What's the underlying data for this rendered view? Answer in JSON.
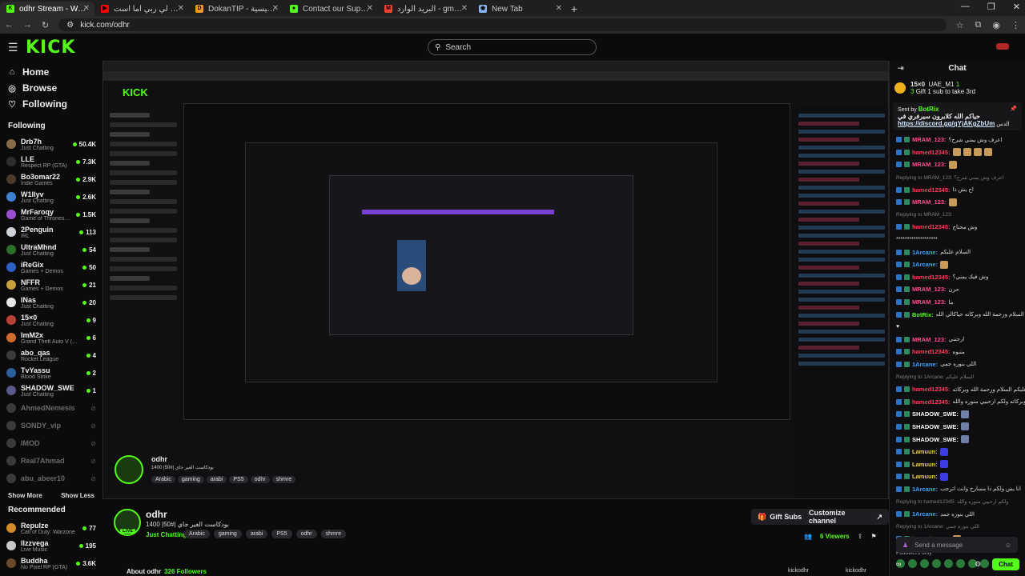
{
  "browser": {
    "tabs": [
      {
        "title": "odhr Stream - Watch Live on Ki",
        "color": "#53fc18",
        "fav": "K",
        "active": true
      },
      {
        "title": "انشودة اذا ما قال لي ربي اما است",
        "color": "#ff0000",
        "fav": "▶",
        "active": false
      },
      {
        "title": "DokanTIP - الرئيسية",
        "color": "#f29a1d",
        "fav": "D",
        "active": false
      },
      {
        "title": "Contact our Support Team | Kic",
        "color": "#53fc18",
        "fav": "●",
        "active": false
      },
      {
        "title": "البريد الوارد - gmail.com - Gmail",
        "color": "#ea4335",
        "fav": "M",
        "active": false
      },
      {
        "title": "New Tab",
        "color": "#8ab4f8",
        "fav": "◉",
        "active": false
      }
    ],
    "url": "kick.com/odhr"
  },
  "header": {
    "logo": "KICK",
    "search_placeholder": "Search"
  },
  "sidebar": {
    "nav": [
      {
        "label": "Home",
        "icon": "home-icon",
        "glyph": "⌂"
      },
      {
        "label": "Browse",
        "icon": "browse-icon",
        "glyph": "◎"
      },
      {
        "label": "Following",
        "icon": "heart-icon",
        "glyph": "♡"
      }
    ],
    "following_title": "Following",
    "following": [
      {
        "name": "Drb7h",
        "game": "Just Chatting",
        "viewers": "50.4K",
        "color": "#8a6b4a"
      },
      {
        "name": "LLE",
        "game": "Respect RP (GTA)",
        "viewers": "7.3K",
        "color": "#2d2d2d"
      },
      {
        "name": "Bo3omar22",
        "game": "Indie Games",
        "viewers": "2.9K",
        "color": "#4a3a2a"
      },
      {
        "name": "W1llyv",
        "game": "Just Chatting",
        "viewers": "2.6K",
        "color": "#3e7fd1"
      },
      {
        "name": "MrFaroqy",
        "game": "Game of Thrones: Kin...",
        "viewers": "1.5K",
        "color": "#9b4fd0"
      },
      {
        "name": "2Penguin",
        "game": "IRL",
        "viewers": "113",
        "color": "#cfd2d6"
      },
      {
        "name": "UltraMhnd",
        "game": "Just Chatting",
        "viewers": "54",
        "color": "#2b6e2b"
      },
      {
        "name": "iReGix",
        "game": "Games + Demos",
        "viewers": "50",
        "color": "#2e5fc5"
      },
      {
        "name": "NFFR",
        "game": "Games + Demos",
        "viewers": "21",
        "color": "#c7a23a"
      },
      {
        "name": "INas",
        "game": "Just Chatting",
        "viewers": "20",
        "color": "#e6e6e6"
      },
      {
        "name": "15×0",
        "game": "Just Chatting",
        "viewers": "9",
        "color": "#b8423a"
      },
      {
        "name": "ImM2x",
        "game": "Grand Theft Auto V (GTA)",
        "viewers": "6",
        "color": "#d06b2a"
      },
      {
        "name": "abo_qas",
        "game": "Rocket League",
        "viewers": "4",
        "color": "#3a3a3a"
      },
      {
        "name": "TvYassu",
        "game": "Blood Strike",
        "viewers": "2",
        "color": "#2c5e99"
      },
      {
        "name": "SHADOW_SWE",
        "game": "Just Chatting",
        "viewers": "1",
        "color": "#5a5a8a"
      }
    ],
    "offline": [
      "AhmedNemesis",
      "SONDY_vip",
      "IMOD",
      "Real7Ahmad",
      "abu_abeer10"
    ],
    "show_more": "Show More",
    "show_less": "Show Less",
    "recommended_title": "Recommended",
    "recommended": [
      {
        "name": "Repulze",
        "game": "Call of Duty: Warzone",
        "viewers": "77",
        "color": "#d08a2a"
      },
      {
        "name": "Ilzzvega",
        "game": "Live Music",
        "viewers": "195",
        "color": "#c9c9c9"
      },
      {
        "name": "Buddha",
        "game": "No Pixel RP (GTA)",
        "viewers": "3.6K",
        "color": "#6a4a2a"
      }
    ]
  },
  "chat": {
    "title": "Chat",
    "pinned_gift": {
      "user": "UAE_M1",
      "count": "15×0",
      "num": "3",
      "subs": "1",
      "text": "Gift 1 sub to take 3rd"
    },
    "pin": {
      "sent_by": "Sent by",
      "bot": "BotRix",
      "line1": "حياكم الله كلابرون سيرفري في",
      "link": "https://discord.gg/qYjAKgZbUm",
      "tail": "الدس"
    },
    "messages": [
      {
        "user": "MRAM_123:",
        "color": "#ff4b8b",
        "text": "اعرف وش يمني شرح؟",
        "emo": ""
      },
      {
        "user": "hamed12345:",
        "color": "#ff3b5b",
        "text": "",
        "emo": "xxxx"
      },
      {
        "user": "MRAM_123:",
        "color": "#ff4b8b",
        "text": "",
        "emo": "e"
      },
      {
        "reply": "Replying to MRAM_123: اعرف وش يمني شرح؟"
      },
      {
        "user": "hamed12345:",
        "color": "#ff3b5b",
        "text": "اح يش ذا",
        "emo": ""
      },
      {
        "user": "MRAM_123:",
        "color": "#ff4b8b",
        "text": "",
        "emo": "e"
      },
      {
        "reply": "Replying to MRAM_123:"
      },
      {
        "user": "hamed12345:",
        "color": "#ff3b5b",
        "text": "وش محتاج",
        "emo": ""
      },
      {
        "user": "",
        "color": "#ddd",
        "text": "*******************",
        "emo": ""
      },
      {
        "user": "1Arcane:",
        "color": "#3ea3ff",
        "text": "السلام عليكم",
        "emo": ""
      },
      {
        "user": "1Arcane:",
        "color": "#3ea3ff",
        "text": "",
        "emo": "e"
      },
      {
        "user": "hamed12345:",
        "color": "#ff3b5b",
        "text": "وش فيك يمني؟",
        "emo": ""
      },
      {
        "user": "MRAM_123:",
        "color": "#ff4b8b",
        "text": "حزن",
        "emo": ""
      },
      {
        "user": "MRAM_123:",
        "color": "#ff4b8b",
        "text": "ما",
        "emo": ""
      },
      {
        "user": "BotRix:",
        "color": "#53fc18",
        "text": "وعليكم السلام ورحمة الله وبركاته حياكالي الله",
        "emo": ""
      },
      {
        "user": "",
        "color": "#ddd",
        "text": "♥",
        "emo": ""
      },
      {
        "user": "MRAM_123:",
        "color": "#ff4b8b",
        "text": "ارحتني",
        "emo": ""
      },
      {
        "user": "hamed12345:",
        "color": "#ff3b5b",
        "text": "متبوه",
        "emo": ""
      },
      {
        "user": "1Arcane:",
        "color": "#3ea3ff",
        "text": "اللي بنوره جمي",
        "emo": ""
      },
      {
        "reply": "Replying to 1Arcane: السلام عليكم"
      },
      {
        "user": "hamed12345:",
        "color": "#ff3b5b",
        "text": "وعليكم السلام ورحمة الله وبركاته",
        "emo": ""
      },
      {
        "user": "hamed12345:",
        "color": "#ff3b5b",
        "text": "وبركاته ولكم ارحبيي منوره والله",
        "emo": ""
      },
      {
        "user": "SHADOW_SWE:",
        "color": "#ffffff",
        "text": "",
        "emo": "x"
      },
      {
        "user": "SHADOW_SWE:",
        "color": "#ffffff",
        "text": "",
        "emo": "x"
      },
      {
        "user": "SHADOW_SWE:",
        "color": "#ffffff",
        "text": "",
        "emo": "x"
      },
      {
        "user": "Lamuun:",
        "color": "#f0d04a",
        "text": "",
        "emo": "b"
      },
      {
        "user": "Lamuun:",
        "color": "#f0d04a",
        "text": "",
        "emo": "b"
      },
      {
        "user": "Lamuun:",
        "color": "#f0d04a",
        "text": "",
        "emo": "b"
      },
      {
        "user": "1Arcane:",
        "color": "#3ea3ff",
        "text": "انا يس ولكم دا مسارح وانت اترجب",
        "emo": ""
      },
      {
        "reply": "Replying to hamed12345: ولكم ارحبيي منوره والله"
      },
      {
        "user": "1Arcane:",
        "color": "#3ea3ff",
        "text": "اللي بنوره جمد",
        "emo": ""
      },
      {
        "reply": "Replying to 1Arcane: اللي بنوره جمي"
      },
      {
        "user": "hamed12345:",
        "color": "#ff3b5b",
        "text": "",
        "emo": "e"
      }
    ],
    "followers_only": "Followers only",
    "send_placeholder": "Send a message",
    "chat_button": "Chat"
  },
  "stream": {
    "name": "odhr",
    "title": "بودكاست الغير جاي |#50| 1400",
    "live": "LIVE",
    "category": "Just Chatting",
    "tags": [
      "Arabic",
      "gaming",
      "arabi",
      "PS5",
      "odhr",
      "shmre"
    ],
    "gift_subs": "Gift Subs",
    "customize": "Customize channel",
    "viewers": "6 Viewers",
    "about": "About odhr",
    "followers": "326 Followers",
    "kick_social": "kickodhr",
    "kick_social2": "kickodhr"
  }
}
